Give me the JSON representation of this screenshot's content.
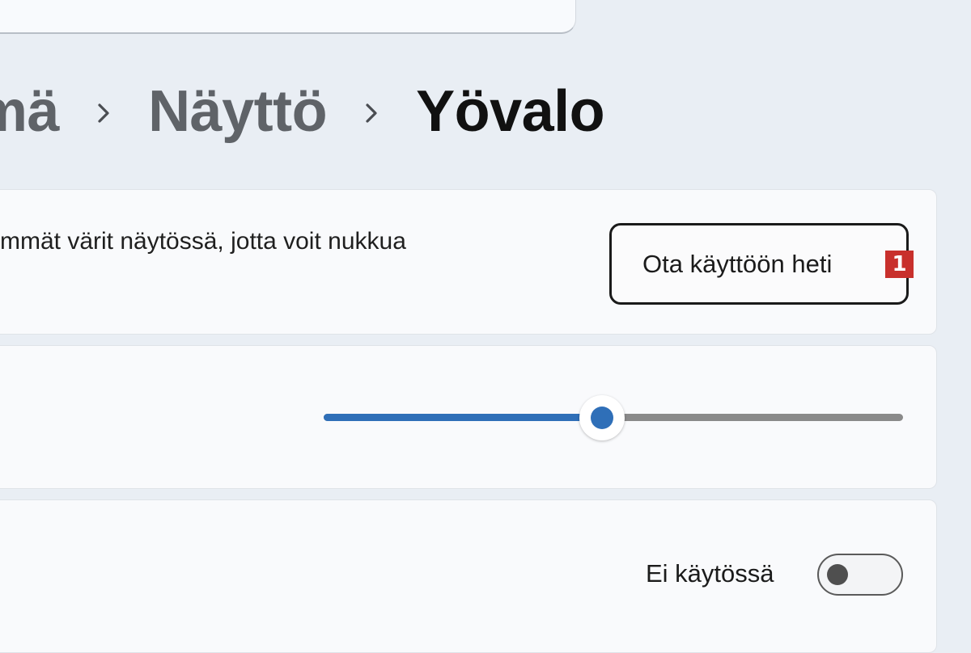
{
  "breadcrumb": {
    "items": [
      "mä",
      "Näyttö",
      "Yövalo"
    ]
  },
  "night_light_card": {
    "description": "mmät värit näytössä, jotta voit nukkua",
    "enable_button_label": "Ota käyttöön heti",
    "marker_label": "1"
  },
  "strength_card": {
    "slider_value_fraction": 0.48
  },
  "schedule_card": {
    "toggle_status": "Ei käytössä",
    "toggle_on": false
  },
  "colors": {
    "accent": "#2f6fb8",
    "marker": "#c8302c",
    "background": "#e9eef4"
  },
  "icons": {
    "breadcrumb_separator": "chevron-right-icon"
  }
}
